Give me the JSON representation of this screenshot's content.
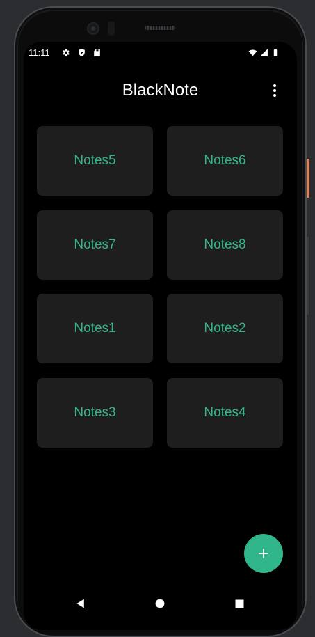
{
  "status_bar": {
    "time": "11:11",
    "icons": [
      "settings-icon",
      "shield-icon",
      "sd-card-icon",
      "wifi-icon",
      "cell-signal-icon",
      "battery-icon"
    ]
  },
  "app_bar": {
    "title": "BlackNote",
    "menu_icon": "more-vert-icon"
  },
  "notes": [
    {
      "label": "Notes5"
    },
    {
      "label": "Notes6"
    },
    {
      "label": "Notes7"
    },
    {
      "label": "Notes8"
    },
    {
      "label": "Notes1"
    },
    {
      "label": "Notes2"
    },
    {
      "label": "Notes3"
    },
    {
      "label": "Notes4"
    }
  ],
  "fab": {
    "icon": "add-icon"
  },
  "nav_bar": {
    "icons": [
      "back-icon",
      "home-icon",
      "recents-icon"
    ]
  },
  "colors": {
    "accent": "#31b58a",
    "card_bg": "#1e1e1e",
    "screen_bg": "#000000",
    "text_primary": "#ffffff"
  }
}
